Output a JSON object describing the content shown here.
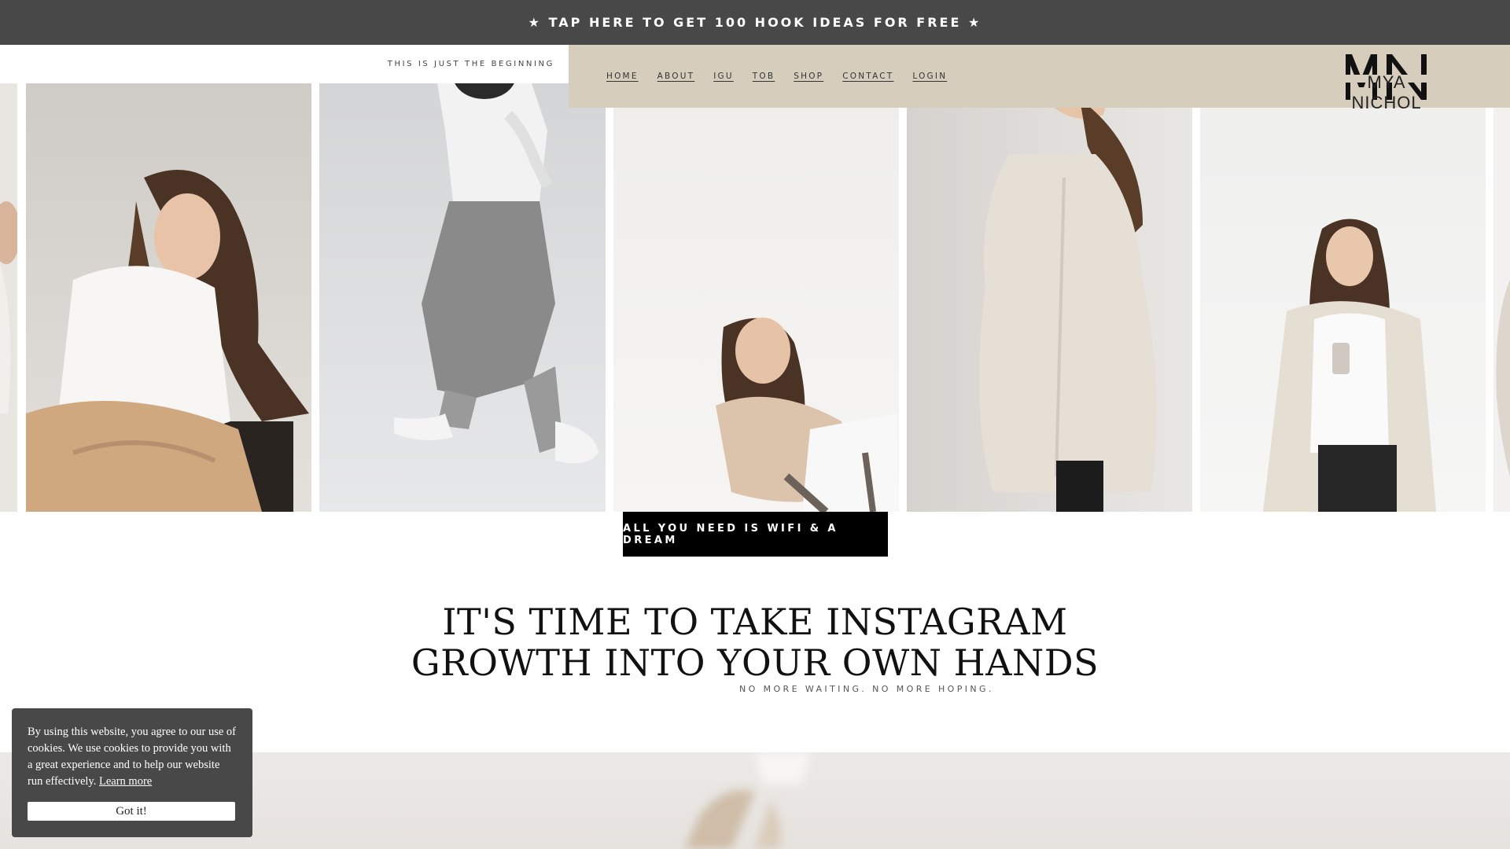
{
  "announcement": {
    "text": "★ TAP HERE TO GET 100 HOOK IDEAS FOR FREE ★"
  },
  "header": {
    "tagline": "THIS IS JUST THE BEGINNING",
    "nav": [
      "HOME",
      "ABOUT",
      "IGU",
      "TOB",
      "SHOP",
      "CONTACT",
      "LOGIN"
    ],
    "logo": {
      "monogram": "MN",
      "name": "MYA NICHOL"
    }
  },
  "gallery": {
    "photos": [
      "woman-partial-left",
      "woman-sitting-smiling",
      "woman-walking-sneakers",
      "woman-chair-sweater",
      "woman-blazer-motion",
      "woman-phone-blazer",
      "woman-partial-right"
    ]
  },
  "cta": {
    "label": "ALL YOU NEED IS WIFI & A DREAM"
  },
  "hero": {
    "headline_line1": "IT'S TIME TO TAKE INSTAGRAM",
    "headline_line2": "GROWTH INTO YOUR OWN HANDS",
    "subline": "NO MORE WAITING. NO MORE HOPING."
  },
  "cookie": {
    "text": "By using this website, you agree to our use of cookies. We use cookies to provide you with a great experience and to help our website run effectively.",
    "link": "Learn more",
    "button": "Got it!"
  },
  "colors": {
    "topbar": "#484848",
    "navbar": "#d7cdbd",
    "cta": "#000000",
    "cookie_bg": "#484848"
  }
}
